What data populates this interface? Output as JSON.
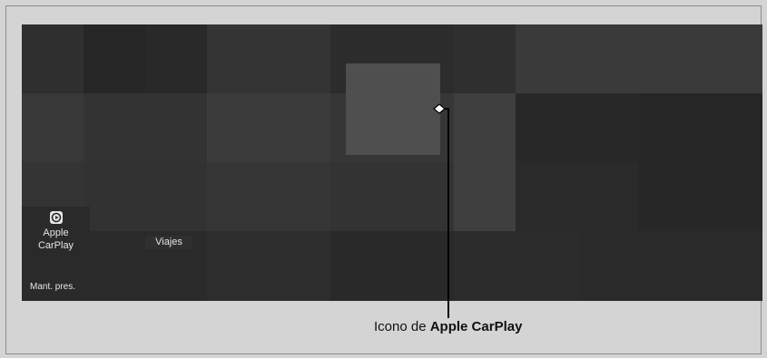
{
  "screen": {
    "apps": [
      {
        "label_line1": "Apple",
        "label_line2": "CarPlay",
        "icon": "apple-carplay-icon"
      }
    ],
    "viajes_label": "Viajes",
    "mant_label": "Mant. pres."
  },
  "callout": {
    "prefix": "Icono de ",
    "bold": "Apple CarPlay"
  }
}
